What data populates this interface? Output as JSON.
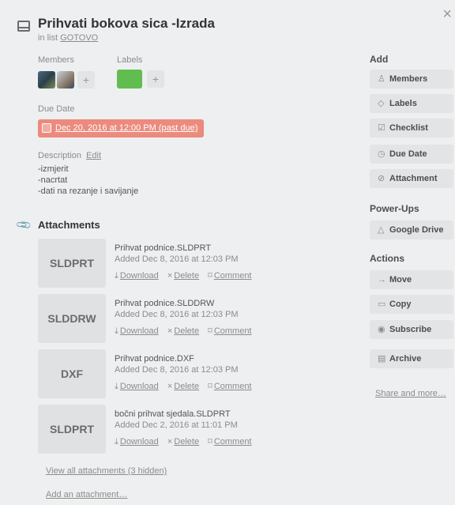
{
  "card": {
    "title": "Prihvati bokova sica -Izrada",
    "in_list_prefix": "in list",
    "list_name": "GOTOVO",
    "close_glyph": "×"
  },
  "members": {
    "label": "Members",
    "add_glyph": "+"
  },
  "labels": {
    "label": "Labels",
    "add_glyph": "+",
    "colors": [
      "#61bd4f"
    ]
  },
  "due": {
    "label": "Due Date",
    "value": "Dec 20, 2016 at 12:00 PM (past due)",
    "color": "#eb8a7d"
  },
  "description": {
    "label": "Description",
    "edit": "Edit",
    "lines": [
      "-izmjerit",
      "-nacrtat",
      "-dati na rezanje i savijanje"
    ]
  },
  "attachments": {
    "title": "Attachments",
    "download": "Download",
    "delete": "Delete",
    "comment": "Comment",
    "items": [
      {
        "thumb": "SLDPRT",
        "name": "Prihvat podnice.SLDPRT",
        "added": "Added Dec 8, 2016 at 12:03 PM"
      },
      {
        "thumb": "SLDDRW",
        "name": "Prihvat podnice.SLDDRW",
        "added": "Added Dec 8, 2016 at 12:03 PM"
      },
      {
        "thumb": "DXF",
        "name": "Prihvat podnice.DXF",
        "added": "Added Dec 8, 2016 at 12:03 PM"
      },
      {
        "thumb": "SLDPRT",
        "name": "bočni prihvat sjedala.SLDPRT",
        "added": "Added Dec 2, 2016 at 11:01 PM"
      }
    ],
    "view_all": "View all attachments (3 hidden)",
    "add": "Add an attachment…"
  },
  "sidebar": {
    "add_head": "Add",
    "add_buttons": [
      {
        "icon": "person-icon",
        "glyph": "♙",
        "label": "Members"
      },
      {
        "icon": "tag-icon",
        "glyph": "◇",
        "label": "Labels"
      },
      {
        "icon": "checklist-icon",
        "glyph": "☑",
        "label": "Checklist"
      },
      {
        "icon": "clock-icon",
        "glyph": "◷",
        "label": "Due Date"
      },
      {
        "icon": "paperclip-icon",
        "glyph": "⊘",
        "label": "Attachment"
      }
    ],
    "powerups_head": "Power-Ups",
    "powerups_buttons": [
      {
        "icon": "google-drive-icon",
        "glyph": "△",
        "label": "Google Drive"
      }
    ],
    "actions_head": "Actions",
    "actions_buttons": [
      {
        "icon": "arrow-right-icon",
        "glyph": "→",
        "label": "Move"
      },
      {
        "icon": "copy-icon",
        "glyph": "▭",
        "label": "Copy"
      },
      {
        "icon": "eye-icon",
        "glyph": "◉",
        "label": "Subscribe"
      },
      {
        "icon": "archive-icon",
        "glyph": "▤",
        "label": "Archive"
      }
    ],
    "share": "Share and more…"
  }
}
